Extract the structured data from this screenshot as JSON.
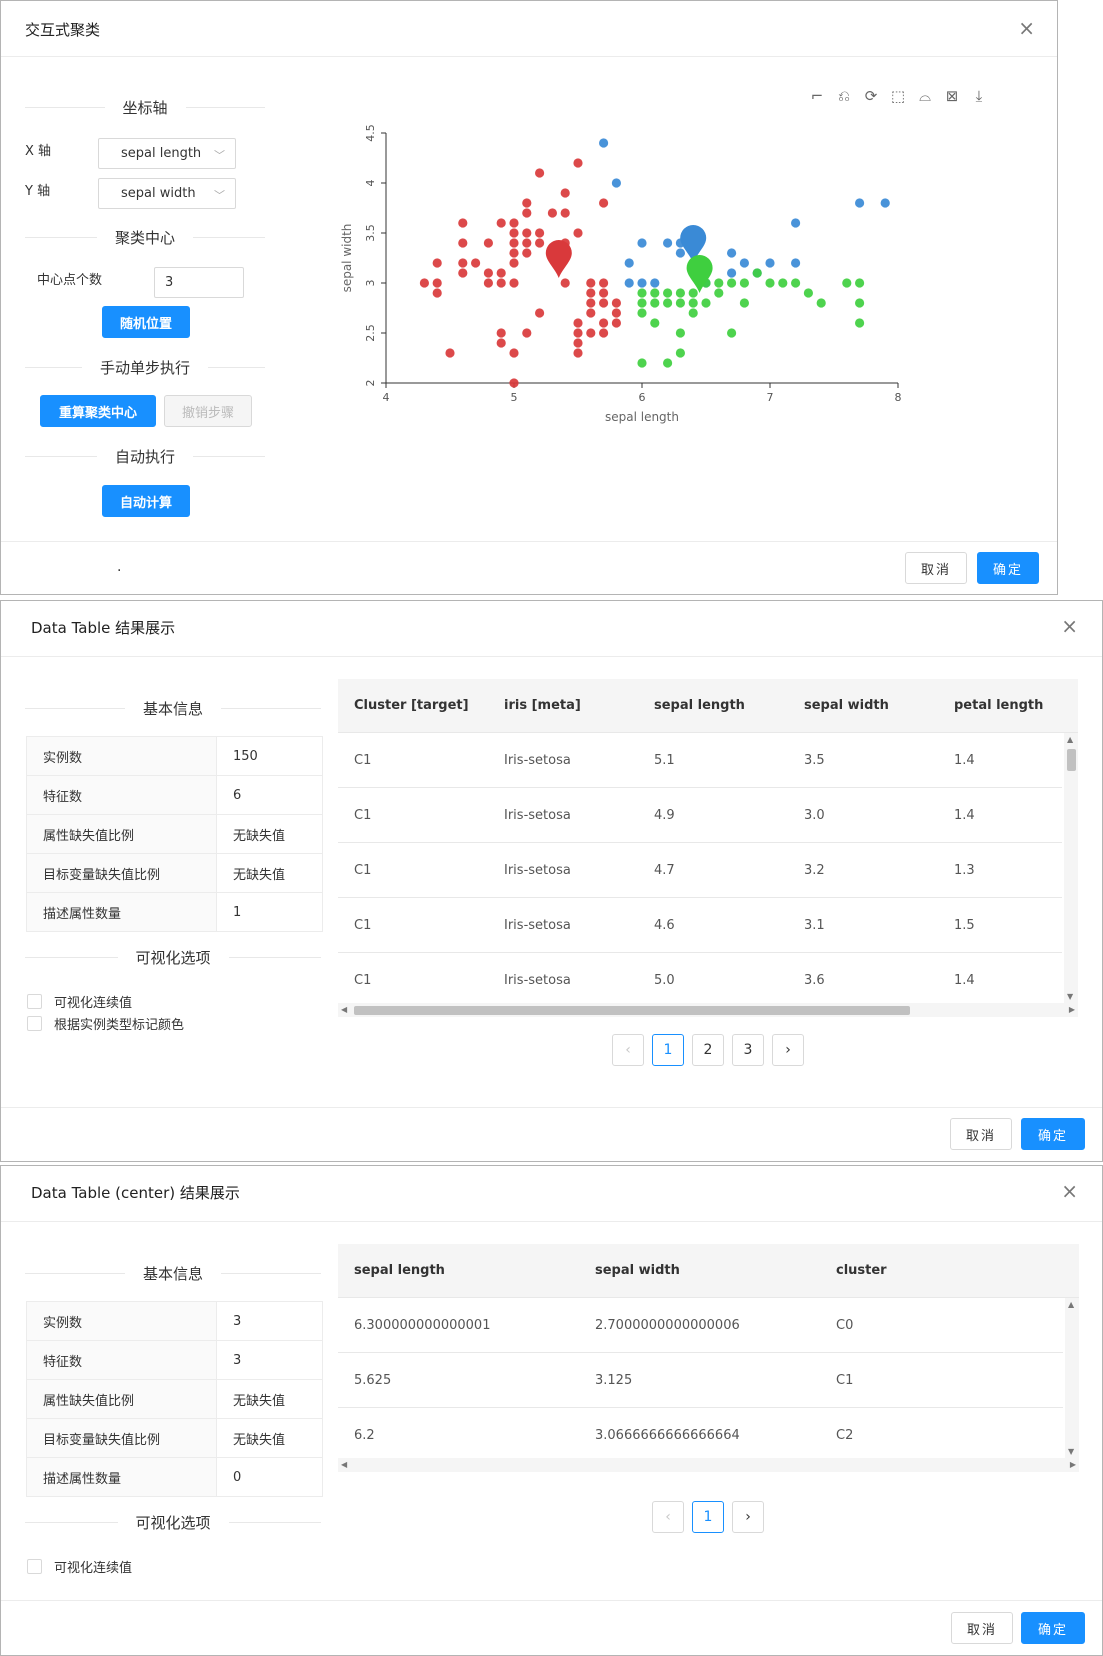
{
  "dialog1": {
    "title": "交互式聚类",
    "close": "×",
    "axes_section": "坐标轴",
    "x_label": "X 轴",
    "x_value": "sepal length",
    "y_label": "Y 轴",
    "y_value": "sepal width",
    "center_section": "聚类中心",
    "center_count_label": "中心点个数",
    "center_count_value": "3",
    "random_btn": "随机位置",
    "manual_section": "手动单步执行",
    "recompute_btn": "重算聚类中心",
    "undo_btn": "撤销步骤",
    "auto_section": "自动执行",
    "auto_btn": "自动计算",
    "footer_dot": ".",
    "cancel": "取消",
    "ok": "确定",
    "toolbar_icons": [
      "crop-icon",
      "crop-undo-icon",
      "refresh-icon",
      "rect-select-icon",
      "lasso-select-icon",
      "clear-select-icon",
      "download-icon"
    ]
  },
  "chart_data": {
    "type": "scatter",
    "xlabel": "sepal length",
    "ylabel": "sepal width",
    "xlim": [
      4,
      8
    ],
    "ylim": [
      2,
      4.5
    ],
    "xticks": [
      "4",
      "5",
      "6",
      "7",
      "8"
    ],
    "yticks": [
      "2",
      "2.5",
      "3",
      "3.5",
      "4",
      "4.5"
    ],
    "grid": false,
    "colors": {
      "red": "#d9393b",
      "blue": "#3a8ad6",
      "green": "#3fcf3f"
    },
    "series": [
      {
        "color": "red",
        "points": [
          [
            4.3,
            3.0
          ],
          [
            4.4,
            2.9
          ],
          [
            4.4,
            3.0
          ],
          [
            4.4,
            3.2
          ],
          [
            4.5,
            2.3
          ],
          [
            4.6,
            3.1
          ],
          [
            4.6,
            3.2
          ],
          [
            4.6,
            3.4
          ],
          [
            4.6,
            3.6
          ],
          [
            4.7,
            3.2
          ],
          [
            4.8,
            3.0
          ],
          [
            4.8,
            3.1
          ],
          [
            4.8,
            3.4
          ],
          [
            4.9,
            2.4
          ],
          [
            4.9,
            2.5
          ],
          [
            4.9,
            3.0
          ],
          [
            4.9,
            3.1
          ],
          [
            5.0,
            2.0
          ],
          [
            5.0,
            2.3
          ],
          [
            5.0,
            3.0
          ],
          [
            5.0,
            3.2
          ],
          [
            5.0,
            3.3
          ],
          [
            5.0,
            3.4
          ],
          [
            5.0,
            3.5
          ],
          [
            5.0,
            3.6
          ],
          [
            5.1,
            2.5
          ],
          [
            5.1,
            3.3
          ],
          [
            5.1,
            3.4
          ],
          [
            5.1,
            3.5
          ],
          [
            5.1,
            3.7
          ],
          [
            5.1,
            3.8
          ],
          [
            5.2,
            2.7
          ],
          [
            5.2,
            3.4
          ],
          [
            5.2,
            3.5
          ],
          [
            5.2,
            4.1
          ],
          [
            5.3,
            3.7
          ],
          [
            5.4,
            3.0
          ],
          [
            5.4,
            3.4
          ],
          [
            5.4,
            3.7
          ],
          [
            5.4,
            3.9
          ],
          [
            5.5,
            2.3
          ],
          [
            5.5,
            2.4
          ],
          [
            5.5,
            2.5
          ],
          [
            5.5,
            2.6
          ],
          [
            5.5,
            3.5
          ],
          [
            5.5,
            4.2
          ],
          [
            5.6,
            2.5
          ],
          [
            5.6,
            2.7
          ],
          [
            5.6,
            2.8
          ],
          [
            5.6,
            2.9
          ],
          [
            5.6,
            3.0
          ],
          [
            5.7,
            2.5
          ],
          [
            5.7,
            2.6
          ],
          [
            5.7,
            2.8
          ],
          [
            5.7,
            2.9
          ],
          [
            5.7,
            3.0
          ],
          [
            5.7,
            3.8
          ],
          [
            5.8,
            2.6
          ],
          [
            5.8,
            2.7
          ],
          [
            5.8,
            2.8
          ],
          [
            4.9,
            3.6
          ]
        ]
      },
      {
        "color": "blue",
        "points": [
          [
            5.7,
            4.4
          ],
          [
            5.8,
            4.0
          ],
          [
            5.9,
            3.0
          ],
          [
            5.9,
            3.2
          ],
          [
            6.0,
            3.4
          ],
          [
            6.0,
            3.0
          ],
          [
            6.1,
            3.0
          ],
          [
            6.2,
            3.4
          ],
          [
            6.3,
            3.3
          ],
          [
            6.3,
            3.4
          ],
          [
            6.4,
            3.1
          ],
          [
            6.4,
            3.2
          ],
          [
            6.5,
            3.2
          ],
          [
            6.5,
            3.0
          ],
          [
            6.7,
            3.1
          ],
          [
            6.7,
            3.3
          ],
          [
            6.8,
            3.2
          ],
          [
            6.9,
            3.1
          ],
          [
            7.0,
            3.2
          ],
          [
            7.2,
            3.2
          ],
          [
            7.2,
            3.6
          ],
          [
            7.7,
            3.8
          ],
          [
            7.9,
            3.8
          ]
        ]
      },
      {
        "color": "green",
        "points": [
          [
            6.0,
            2.2
          ],
          [
            6.2,
            2.2
          ],
          [
            6.3,
            2.3
          ],
          [
            6.0,
            2.7
          ],
          [
            6.1,
            2.6
          ],
          [
            6.0,
            2.8
          ],
          [
            6.0,
            2.9
          ],
          [
            6.1,
            2.8
          ],
          [
            6.1,
            2.9
          ],
          [
            6.2,
            2.8
          ],
          [
            6.2,
            2.9
          ],
          [
            6.3,
            2.5
          ],
          [
            6.3,
            2.8
          ],
          [
            6.3,
            2.9
          ],
          [
            6.4,
            2.7
          ],
          [
            6.4,
            2.8
          ],
          [
            6.4,
            2.9
          ],
          [
            6.5,
            2.8
          ],
          [
            6.5,
            3.0
          ],
          [
            6.6,
            2.9
          ],
          [
            6.6,
            3.0
          ],
          [
            6.7,
            2.5
          ],
          [
            6.7,
            3.0
          ],
          [
            6.8,
            2.8
          ],
          [
            6.8,
            3.0
          ],
          [
            6.9,
            3.1
          ],
          [
            7.0,
            3.0
          ],
          [
            7.1,
            3.0
          ],
          [
            7.2,
            3.0
          ],
          [
            7.3,
            2.9
          ],
          [
            7.4,
            2.8
          ],
          [
            7.6,
            3.0
          ],
          [
            7.7,
            2.6
          ],
          [
            7.7,
            2.8
          ],
          [
            7.7,
            3.0
          ]
        ]
      }
    ],
    "centers": [
      {
        "color": "red",
        "x": 5.35,
        "y": 3.3
      },
      {
        "color": "blue",
        "x": 6.4,
        "y": 3.45
      },
      {
        "color": "green",
        "x": 6.45,
        "y": 3.15
      }
    ]
  },
  "dialog2": {
    "title": "Data Table 结果展示",
    "close": "×",
    "info_section": "基本信息",
    "info": [
      {
        "k": "实例数",
        "v": "150"
      },
      {
        "k": "特征数",
        "v": "6"
      },
      {
        "k": "属性缺失值比例",
        "v": "无缺失值"
      },
      {
        "k": "目标变量缺失值比例",
        "v": "无缺失值"
      },
      {
        "k": "描述属性数量",
        "v": "1"
      }
    ],
    "vis_section": "可视化选项",
    "check1": "可视化连续值",
    "check2": "根据实例类型标记颜色",
    "columns": [
      "Cluster [target]",
      "iris [meta]",
      "sepal length",
      "sepal width",
      "petal length"
    ],
    "rows": [
      [
        "C1",
        "Iris-setosa",
        "5.1",
        "3.5",
        "1.4"
      ],
      [
        "C1",
        "Iris-setosa",
        "4.9",
        "3.0",
        "1.4"
      ],
      [
        "C1",
        "Iris-setosa",
        "4.7",
        "3.2",
        "1.3"
      ],
      [
        "C1",
        "Iris-setosa",
        "4.6",
        "3.1",
        "1.5"
      ],
      [
        "C1",
        "Iris-setosa",
        "5.0",
        "3.6",
        "1.4"
      ]
    ],
    "pages": [
      "1",
      "2",
      "3"
    ],
    "current_page": "1",
    "cancel": "取消",
    "ok": "确定"
  },
  "dialog3": {
    "title": "Data Table (center) 结果展示",
    "close": "×",
    "info_section": "基本信息",
    "info": [
      {
        "k": "实例数",
        "v": "3"
      },
      {
        "k": "特征数",
        "v": "3"
      },
      {
        "k": "属性缺失值比例",
        "v": "无缺失值"
      },
      {
        "k": "目标变量缺失值比例",
        "v": "无缺失值"
      },
      {
        "k": "描述属性数量",
        "v": "0"
      }
    ],
    "vis_section": "可视化选项",
    "check1": "可视化连续值",
    "columns": [
      "sepal length",
      "sepal width",
      "cluster"
    ],
    "rows": [
      [
        "6.300000000000001",
        "2.7000000000000006",
        "C0"
      ],
      [
        "5.625",
        "3.125",
        "C1"
      ],
      [
        "6.2",
        "3.0666666666666664",
        "C2"
      ]
    ],
    "pages": [
      "1"
    ],
    "current_page": "1",
    "cancel": "取消",
    "ok": "确定"
  }
}
